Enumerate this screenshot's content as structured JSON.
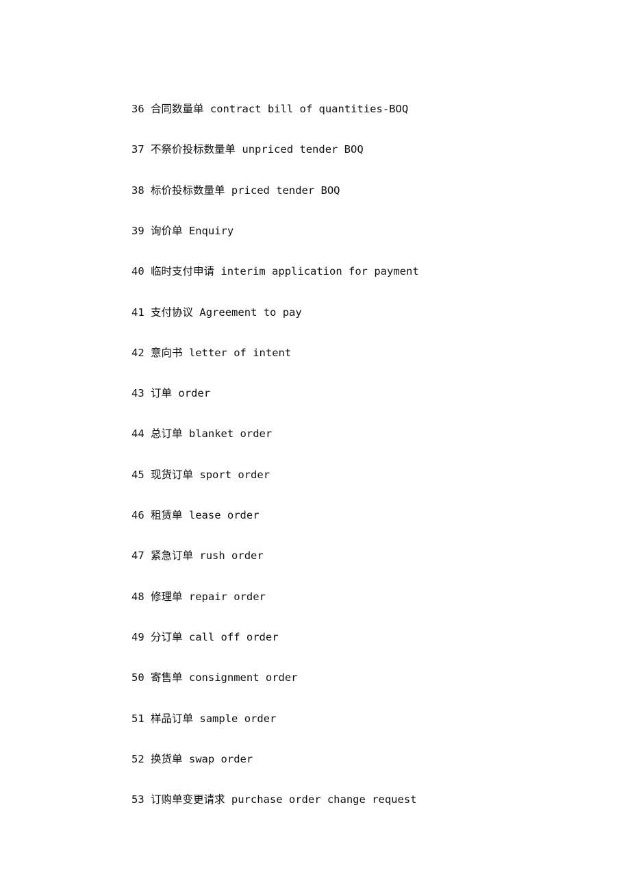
{
  "entries": [
    {
      "num": "36",
      "zh": "合同数量单",
      "en": "contract bill of quantities-BOQ"
    },
    {
      "num": "37",
      "zh": "不祭价投标数量单",
      "en": "unpriced tender BOQ"
    },
    {
      "num": "38",
      "zh": "标价投标数量单",
      "en": "priced tender BOQ"
    },
    {
      "num": "39",
      "zh": "询价单",
      "en": "Enquiry"
    },
    {
      "num": "40",
      "zh": "临时支付申请",
      "en": "interim application for payment"
    },
    {
      "num": "41",
      "zh": "支付协议",
      "en": "Agreement to pay"
    },
    {
      "num": "42",
      "zh": "意向书",
      "en": "letter of intent"
    },
    {
      "num": "43",
      "zh": "订单",
      "en": "order"
    },
    {
      "num": "44",
      "zh": "总订单",
      "en": "blanket order"
    },
    {
      "num": "45",
      "zh": "现货订单",
      "en": "sport order"
    },
    {
      "num": "46",
      "zh": "租赁单",
      "en": "lease order"
    },
    {
      "num": "47",
      "zh": "紧急订单",
      "en": "rush order"
    },
    {
      "num": "48",
      "zh": "修理单",
      "en": "repair order"
    },
    {
      "num": "49",
      "zh": "分订单",
      "en": "call off order"
    },
    {
      "num": "50",
      "zh": "寄售单",
      "en": "consignment order"
    },
    {
      "num": "51",
      "zh": "样品订单",
      "en": "sample order"
    },
    {
      "num": "52",
      "zh": "换货单",
      "en": "swap order"
    },
    {
      "num": "53",
      "zh": "订购单变更请求",
      "en": "purchase order change request"
    }
  ]
}
